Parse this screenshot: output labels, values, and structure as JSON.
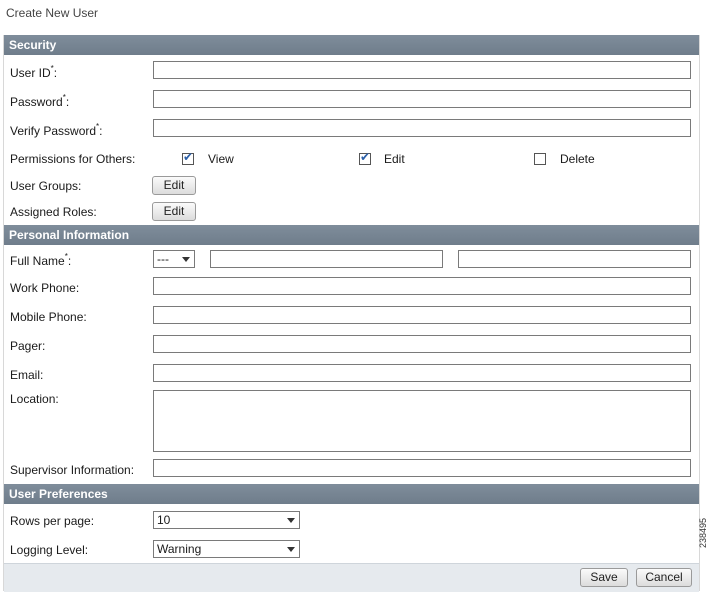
{
  "page_title": "Create New User",
  "sections": {
    "security": "Security",
    "personal": "Personal Information",
    "preferences": "User Preferences"
  },
  "security": {
    "user_id_label": "User ID",
    "password_label": "Password",
    "verify_password_label": "Verify Password",
    "required_marker": "*",
    "colon": ":",
    "user_id_value": "",
    "password_value": "",
    "verify_password_value": "",
    "permissions_label": "Permissions for Others:",
    "perm_view_label": "View",
    "perm_edit_label": "Edit",
    "perm_delete_label": "Delete",
    "perm_view_checked": true,
    "perm_edit_checked": true,
    "perm_delete_checked": false,
    "user_groups_label": "User Groups:",
    "assigned_roles_label": "Assigned Roles:",
    "edit_button": "Edit"
  },
  "personal": {
    "full_name_label": "Full Name",
    "salutation_value": "---",
    "work_phone_label": "Work Phone:",
    "mobile_phone_label": "Mobile Phone:",
    "pager_label": "Pager:",
    "email_label": "Email:",
    "location_label": "Location:",
    "supervisor_label": "Supervisor Information:"
  },
  "preferences": {
    "rows_label": "Rows per page:",
    "rows_value": "10",
    "logging_label": "Logging Level:",
    "logging_value": "Warning"
  },
  "footer": {
    "save_label": "Save",
    "cancel_label": "Cancel"
  },
  "side_id": "238495",
  "icons": {
    "checkmark": "check-icon",
    "dropdown": "chevron-down-icon"
  }
}
